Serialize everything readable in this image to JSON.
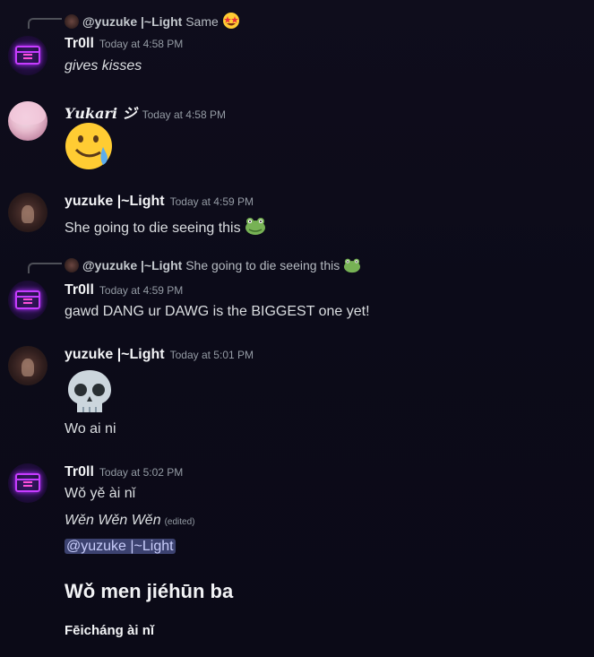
{
  "messages": [
    {
      "reply": {
        "author": "@yuzuke |~Light",
        "text": "Same"
      },
      "author": "Tr0ll",
      "time": "Today at 4:58 PM",
      "lines": [
        "gives kisses"
      ]
    },
    {
      "author": "𝒀𝒖𝒌𝒂𝒓𝒊 ジ",
      "time": "Today at 4:58 PM",
      "emoji": "crying-smile-emoji"
    },
    {
      "author": "yuzuke |~Light",
      "time": "Today at 4:59 PM",
      "lines": [
        "She going to die seeing this"
      ]
    },
    {
      "reply": {
        "author": "@yuzuke |~Light",
        "text": "She going to die seeing this"
      },
      "author": "Tr0ll",
      "time": "Today at 4:59 PM",
      "lines": [
        "gawd DANG ur DAWG is the BIGGEST one yet!"
      ]
    },
    {
      "author": "yuzuke |~Light",
      "time": "Today at 5:01 PM",
      "emoji": "skull-emoji",
      "lines": [
        "Wo ai ni"
      ]
    },
    {
      "author": "Tr0ll",
      "time": "Today at 5:02 PM",
      "lines": [
        "Wǒ yě ài nǐ",
        "Wěn Wěn Wěn"
      ],
      "edited": "(edited)",
      "mention": "@yuzuke |~Light",
      "heading": "Wǒ men jiéhūn ba",
      "subheading": "Fēicháng ài nǐ"
    }
  ],
  "colors": {
    "background": "#0c0b19",
    "username": "#f2f3f5",
    "timestamp": "#949ba4",
    "mention_bg": "#3c4270",
    "mention_text": "#c9cdfb"
  }
}
